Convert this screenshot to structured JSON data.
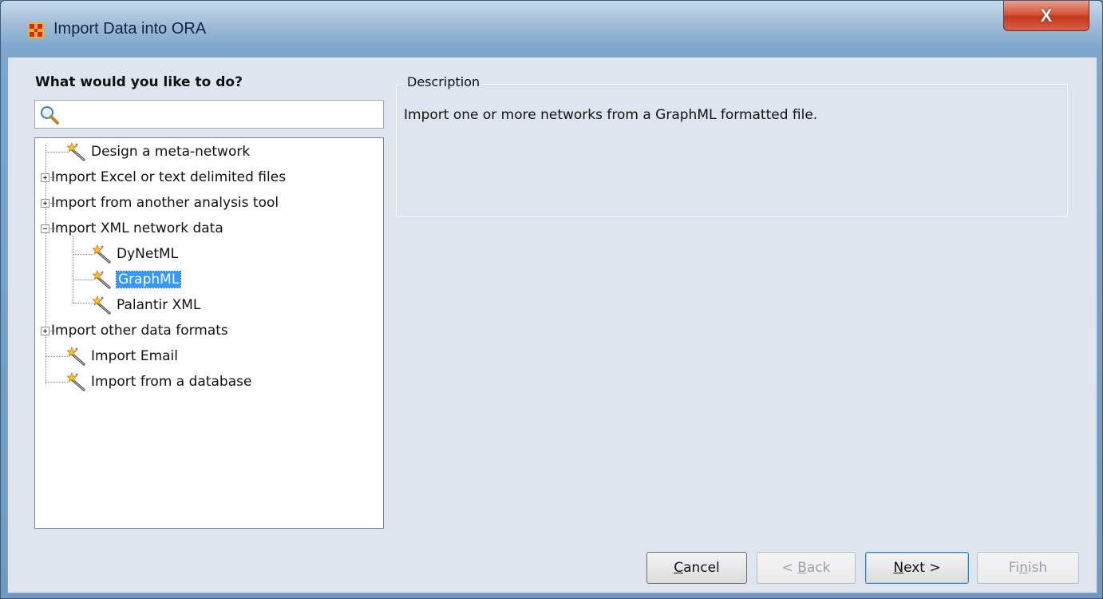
{
  "window": {
    "title": "Import Data into ORA",
    "close_label": "X"
  },
  "left": {
    "heading": "What would you like to do?",
    "search": {
      "value": "",
      "placeholder": ""
    }
  },
  "tree": {
    "items": [
      {
        "label": "Design a meta-network",
        "type": "wizard"
      },
      {
        "label": "Import Excel or text delimited files",
        "type": "collapsed-group"
      },
      {
        "label": "Import from another analysis tool",
        "type": "collapsed-group"
      },
      {
        "label": "Import XML network data",
        "type": "expanded-group"
      },
      {
        "label": "DyNetML",
        "type": "wizard"
      },
      {
        "label": "GraphML",
        "type": "wizard",
        "selected": true
      },
      {
        "label": "Palantir XML",
        "type": "wizard"
      },
      {
        "label": "Import other data formats",
        "type": "collapsed-group"
      },
      {
        "label": "Import Email",
        "type": "wizard"
      },
      {
        "label": "Import from a database",
        "type": "wizard"
      }
    ]
  },
  "description": {
    "title": "Description",
    "text": "Import one or more networks from a GraphML formatted file."
  },
  "buttons": {
    "cancel": {
      "label": "Cancel",
      "mnemonic_index": 0
    },
    "back": {
      "prefix": "< ",
      "mnemonic": "B",
      "rest": "ack",
      "enabled": false
    },
    "next": {
      "mnemonic": "N",
      "rest": "ext >",
      "enabled": true
    },
    "finish": {
      "pre": "Fi",
      "mnemonic": "n",
      "rest": "ish",
      "enabled": false
    }
  },
  "colors": {
    "selection": "#3399ff",
    "close_button": "#c3381b",
    "panel_background": "#dee5ee"
  }
}
